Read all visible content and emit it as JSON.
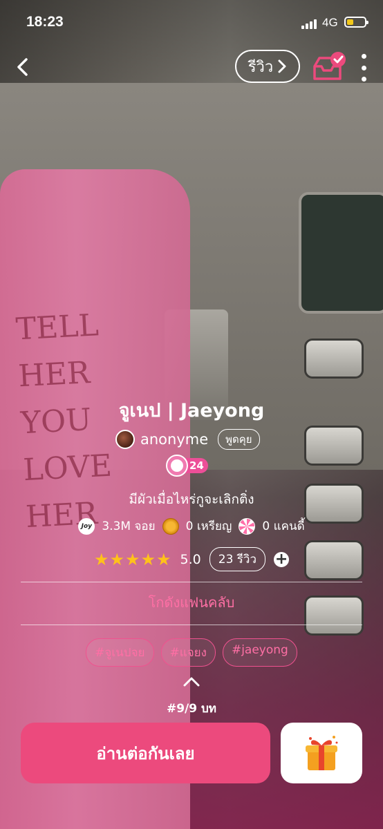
{
  "status_bar": {
    "time": "18:23",
    "network": "4G"
  },
  "header": {
    "review_label": "รีวิว"
  },
  "story": {
    "title": "จูเนป | Jaeyong",
    "author": "anonyme",
    "chat_label": "พูดคุย",
    "level": "24",
    "tagline": "มีผัวเมื่อไหร่กูจะเลิกติ่ง"
  },
  "stats": {
    "joy_icon_text": "Joy",
    "joy": "3.3M จอย",
    "coins": "0 เหรียญ",
    "candy": "0 แคนดี้"
  },
  "rating": {
    "stars": "★★★★★",
    "value": "5.0",
    "reviews": "23 รีวิว"
  },
  "fanclub_label": "โกดังแฟนคลับ",
  "tags": [
    "#จูเนปจย",
    "#แจยง",
    "#jaeyong"
  ],
  "chapter": "#9/9 บท",
  "read_button": "อ่านต่อกันเลย",
  "background_photo_text": "TELL\nHER\nYOU\nLOVE\nHER",
  "colors": {
    "accent": "#ec4a7d",
    "tag": "#ff6fa5",
    "star": "#ffc21a"
  },
  "icons": [
    "back-icon",
    "chevron-right-icon",
    "library-icon",
    "more-icon",
    "joy-icon",
    "coin-icon",
    "candy-icon",
    "plus-icon",
    "chevron-up-icon",
    "gift-icon"
  ]
}
